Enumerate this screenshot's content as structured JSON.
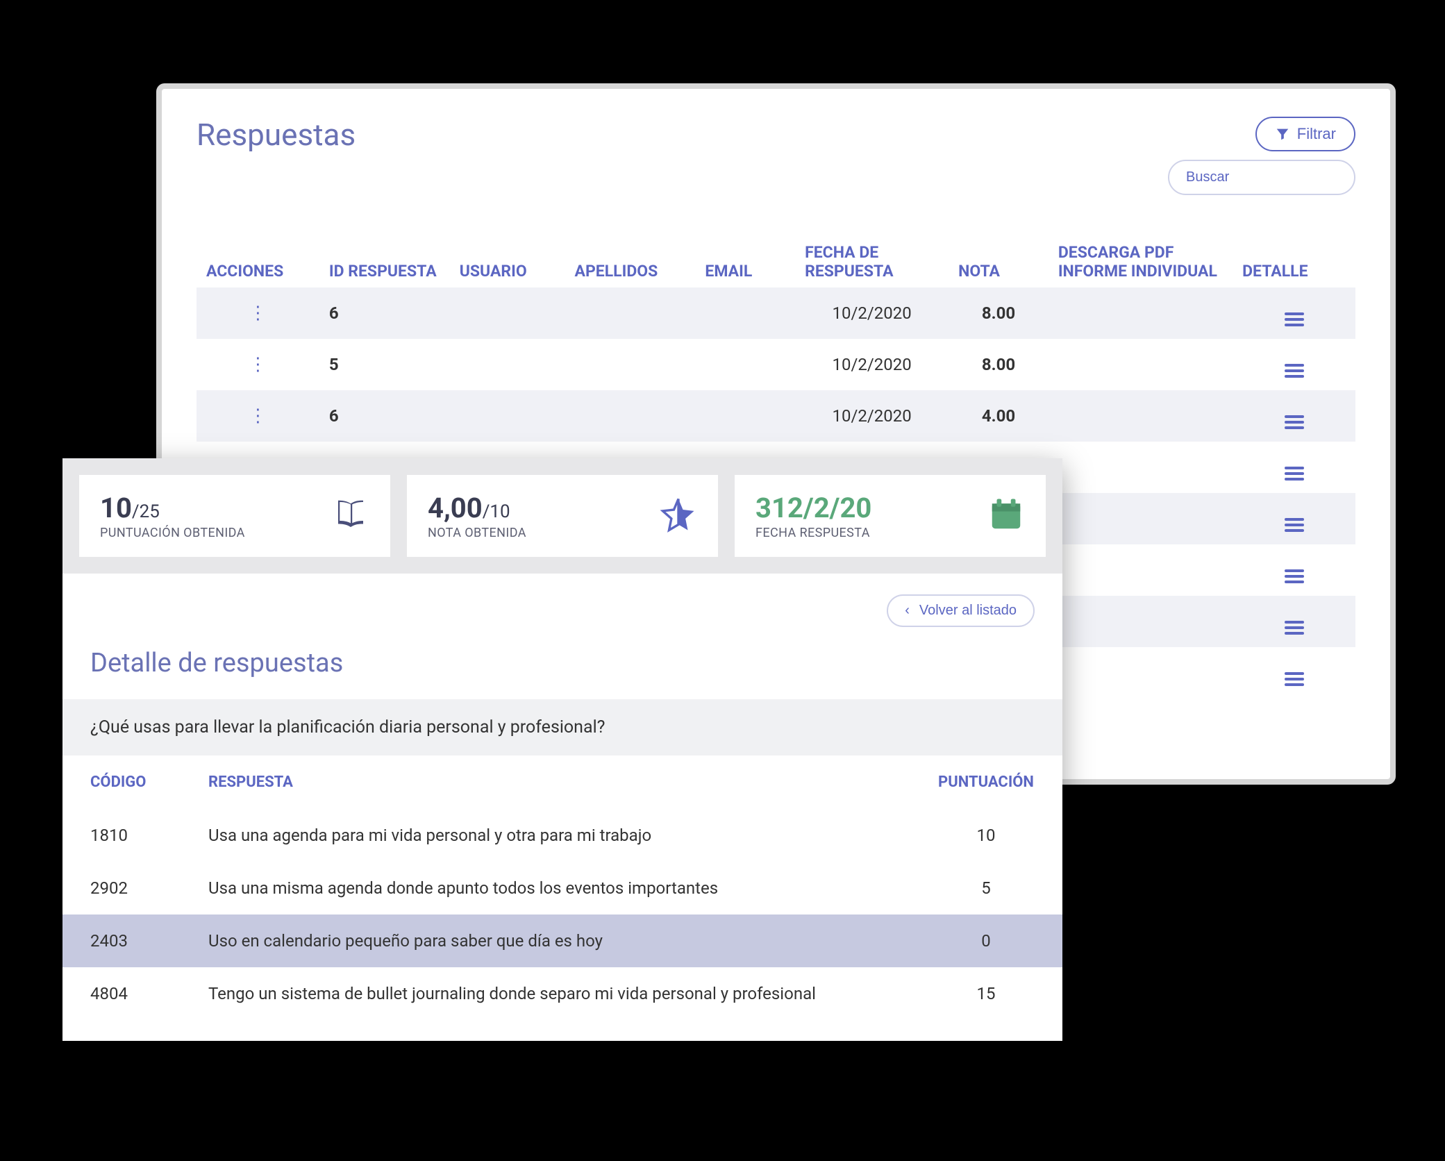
{
  "back": {
    "title": "Respuestas",
    "filter_label": "Filtrar",
    "search_placeholder": "Buscar",
    "columns": {
      "acciones": "ACCIONES",
      "id": "ID RESPUESTA",
      "usuario": "USUARIO",
      "apellidos": "APELLIDOS",
      "email": "EMAIL",
      "fecha": "FECHA DE RESPUESTA",
      "nota": "NOTA",
      "pdf": "DESCARGA PDF INFORME INDIVIDUAL",
      "detalle": "DETALLE"
    },
    "rows": [
      {
        "id": "6",
        "fecha": "10/2/2020",
        "nota": "8.00",
        "nota_class": "green"
      },
      {
        "id": "5",
        "fecha": "10/2/2020",
        "nota": "8.00",
        "nota_class": "green"
      },
      {
        "id": "6",
        "fecha": "10/2/2020",
        "nota": "4.00",
        "nota_class": "red"
      },
      {
        "id": "",
        "fecha": "",
        "nota": "",
        "nota_class": ""
      },
      {
        "id": "",
        "fecha": "",
        "nota": "",
        "nota_class": ""
      },
      {
        "id": "",
        "fecha": "",
        "nota": "",
        "nota_class": ""
      },
      {
        "id": "",
        "fecha": "",
        "nota": "",
        "nota_class": ""
      },
      {
        "id": "",
        "fecha": "",
        "nota": "",
        "nota_class": ""
      }
    ]
  },
  "front": {
    "stats": {
      "score": {
        "value": "10",
        "max": "/25",
        "label": "PUNTUACIÓN OBTENIDA"
      },
      "grade": {
        "value": "4,00",
        "max": "/10",
        "label": "NOTA OBTENIDA"
      },
      "date": {
        "value": "312/2/20",
        "label": "FECHA RESPUESTA"
      }
    },
    "back_link": "Volver al listado",
    "title": "Detalle de respuestas",
    "question": "¿Qué usas para llevar la planificación diaria personal y profesional?",
    "columns": {
      "codigo": "CÓDIGO",
      "respuesta": "RESPUESTA",
      "puntuacion": "PUNTUACIÓN"
    },
    "answers": [
      {
        "codigo": "1810",
        "respuesta": "Usa una agenda para mi vida personal y otra para mi trabajo",
        "puntuacion": "10",
        "highlight": false
      },
      {
        "codigo": "2902",
        "respuesta": "Usa una misma agenda donde apunto todos los eventos importantes",
        "puntuacion": "5",
        "highlight": false
      },
      {
        "codigo": "2403",
        "respuesta": "Uso en  calendario pequeño para saber que día es hoy",
        "puntuacion": "0",
        "highlight": true
      },
      {
        "codigo": "4804",
        "respuesta": "Tengo un sistema de bullet journaling donde separo mi vida personal y profesional",
        "puntuacion": "15",
        "highlight": false
      }
    ]
  }
}
